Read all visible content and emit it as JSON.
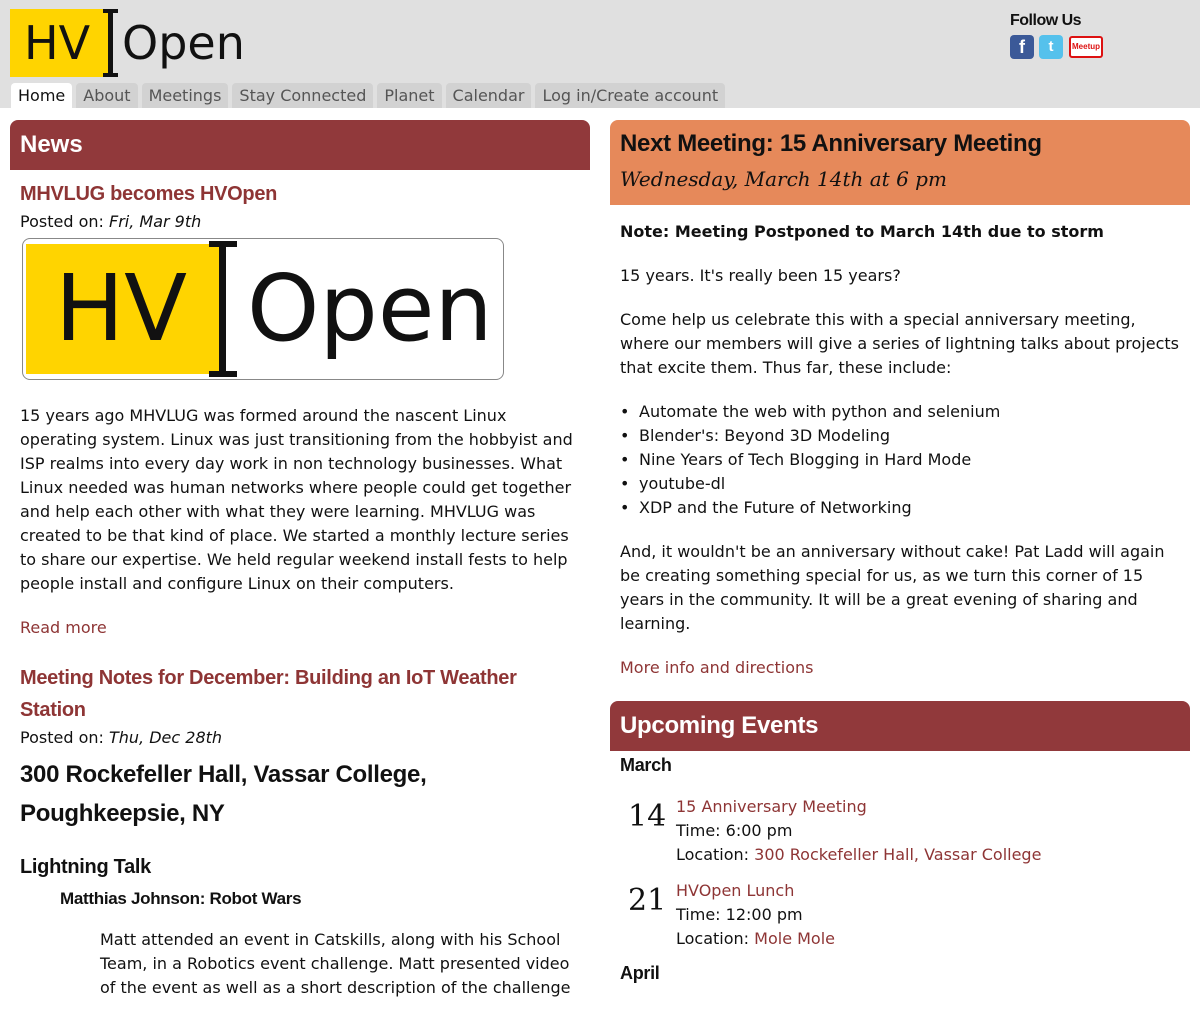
{
  "header": {
    "logo_hv": "HV",
    "logo_open": "Open",
    "follow_label": "Follow Us",
    "social": {
      "facebook": "f",
      "twitter": "t",
      "meetup": "Meetup"
    }
  },
  "nav": [
    {
      "label": "Home"
    },
    {
      "label": "About"
    },
    {
      "label": "Meetings"
    },
    {
      "label": "Stay Connected"
    },
    {
      "label": "Planet"
    },
    {
      "label": "Calendar"
    },
    {
      "label": "Log in/Create account"
    }
  ],
  "news": {
    "heading": "News",
    "article1": {
      "title": "MHVLUG becomes HVOpen",
      "posted_prefix": "Posted on:",
      "posted_date": "Fri, Mar 9th",
      "image_hv": "HV",
      "image_open": "Open",
      "body": "15 years ago MHVLUG was formed around the nascent Linux operating system. Linux was just transitioning from the hobbyist and ISP realms into every day work in non technology businesses. What Linux needed was human networks where people could get together and help each other with what they were learning. MHVLUG was created to be that kind of place. We started a monthly lecture series to share our expertise. We held regular weekend install fests to help people install and configure Linux on their computers.",
      "read_more": "Read more"
    },
    "article2": {
      "title": "Meeting Notes for December: Building an IoT Weather Station",
      "posted_prefix": "Posted on:",
      "posted_date": "Thu, Dec 28th",
      "location_heading": "300 Rockefeller Hall, Vassar College, Poughkeepsie, NY",
      "section_heading": "Lightning Talk",
      "talk_heading": "Matthias Johnson: Robot Wars",
      "talk_body": "Matt attended an event in Catskills, along with his School Team, in a Robotics event challenge. Matt presented video of the event as well as a short description of the challenge"
    }
  },
  "next_meeting": {
    "title": "Next Meeting: 15 Anniversary Meeting",
    "date": "Wednesday, March 14th at 6 pm",
    "note": "Note: Meeting Postponed to March 14th due to storm",
    "para1": "15 years. It's really been 15 years?",
    "para2": "Come help us celebrate this with a special anniversary meeting, where our members will give a series of lightning talks about projects that excite them. Thus far, these include:",
    "talks": [
      "Automate the web with python and selenium",
      "Blender's: Beyond 3D Modeling",
      "Nine Years of Tech Blogging in Hard Mode",
      "youtube-dl",
      "XDP and the Future of Networking"
    ],
    "para3": "And, it wouldn't be an anniversary without cake! Pat Ladd will again be creating something special for us, as we turn this corner of 15 years in the community. It will be a great evening of sharing and learning.",
    "more_info": "More info and directions"
  },
  "events": {
    "heading": "Upcoming Events",
    "month1": "March",
    "month2": "April",
    "list": [
      {
        "day": "14",
        "title": "15 Anniversary Meeting",
        "time_label": "Time:",
        "time": "6:00 pm",
        "location_label": "Location:",
        "location": "300 Rockefeller Hall, Vassar College"
      },
      {
        "day": "21",
        "title": "HVOpen Lunch",
        "time_label": "Time:",
        "time": "12:00 pm",
        "location_label": "Location:",
        "location": "Mole Mole"
      }
    ]
  }
}
